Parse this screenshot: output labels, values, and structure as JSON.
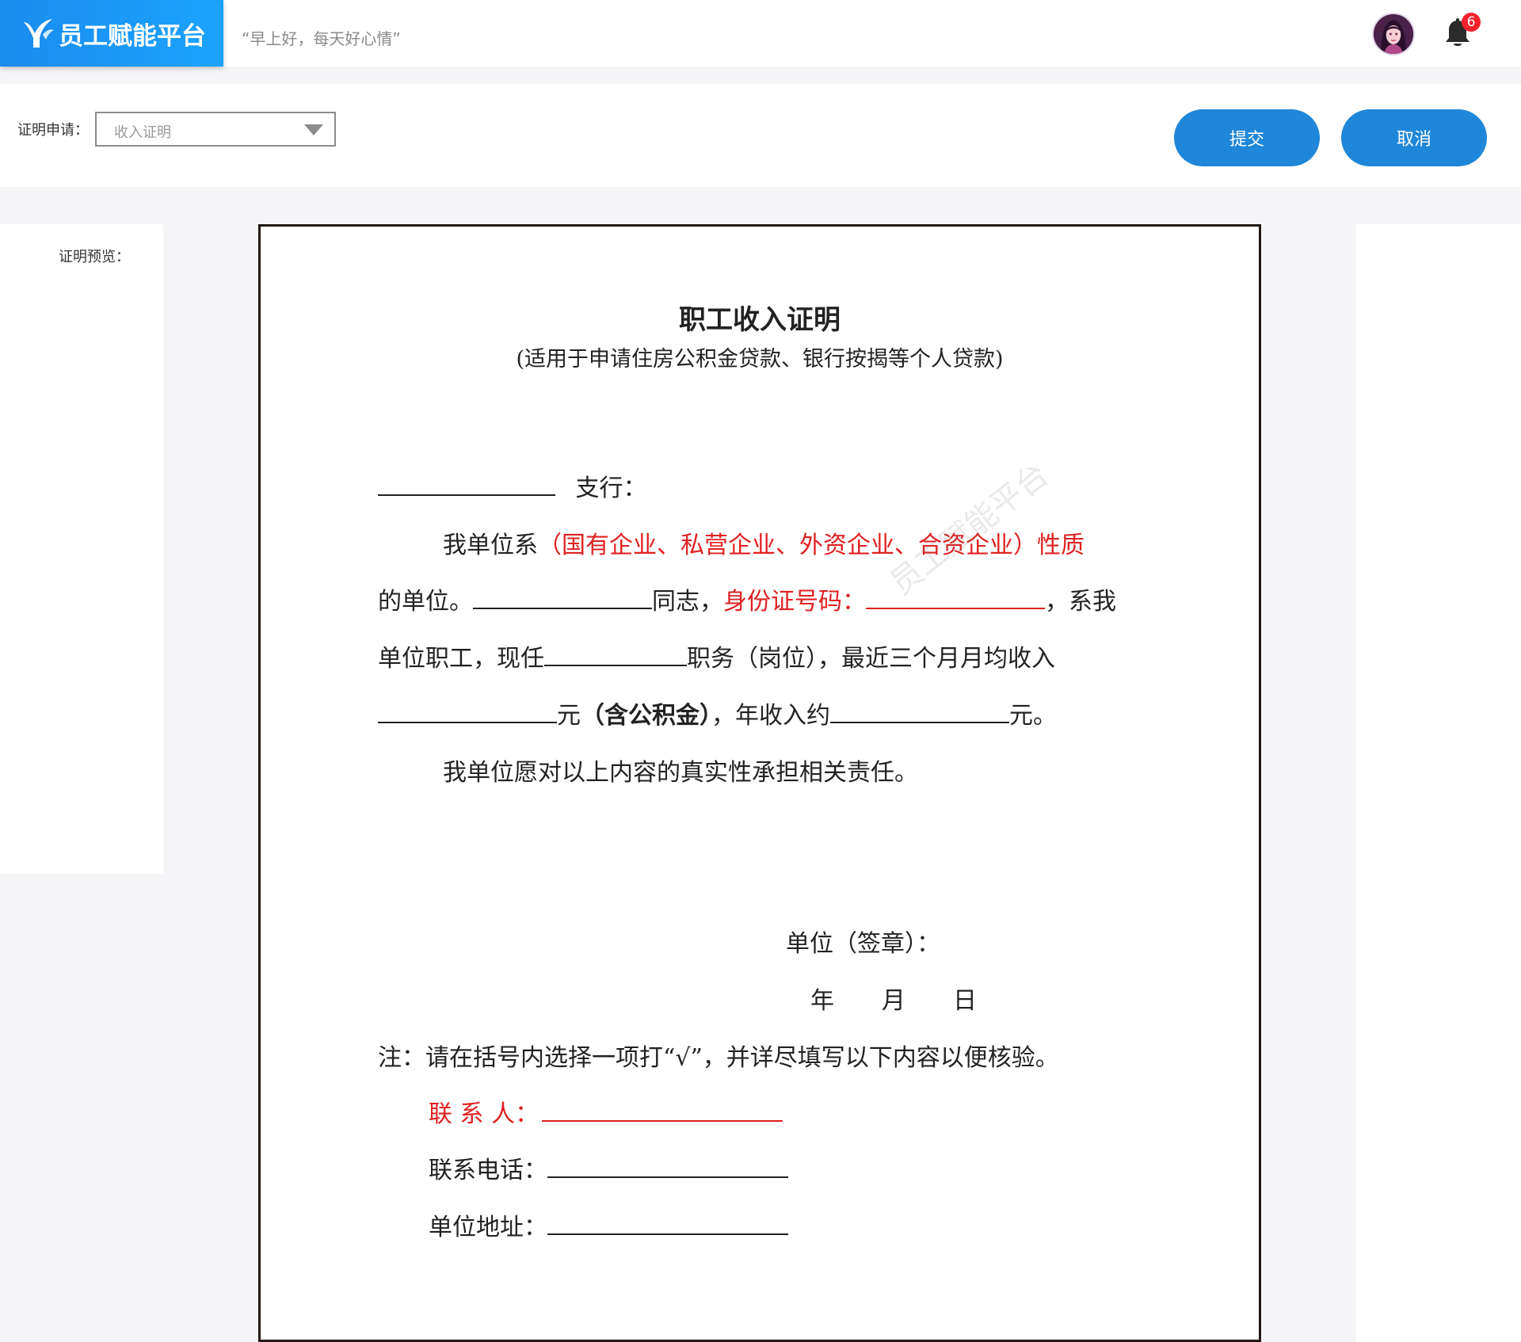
{
  "header": {
    "app_name": "员工赋能平台",
    "greeting": "“早上好，每天好心情”",
    "notification_count": "6"
  },
  "toolbar": {
    "cert_label": "证明申请：",
    "cert_type": "收入证明",
    "submit_label": "提交",
    "cancel_label": "取消"
  },
  "preview": {
    "label": "证明预览："
  },
  "document": {
    "title": "职工收入证明",
    "subtitle": "(适用于申请住房公积金贷款、银行按揭等个人贷款)",
    "branch_suffix": "支行：",
    "p1_start": "我单位系",
    "p1_options": "（国有企业、私营企业、外资企业、合资企业）性质",
    "p2_start": "的单位。",
    "p2_comrade": "同志，",
    "p2_id_label": "身份证号码：",
    "p2_end": "，系我",
    "p3_start": "单位职工，现任",
    "p3_mid": "职务（岗位），最近三个月月均收入",
    "p4_yuan": "元",
    "p4_bold": "（含公积金）",
    "p4_mid": "，年收入约",
    "p4_end": "元。",
    "p5": "我单位愿对以上内容的真实性承担相关责任。",
    "seal": "单位（签章）：",
    "date": "年　　月　　日",
    "note": "注：请在括号内选择一项打“√”，并详尽填写以下内容以便核验。",
    "contact_label": "联 系 人：",
    "phone_label": "联系电话：",
    "address_label": "单位地址：",
    "watermark": "员工赋能平台"
  },
  "colors": {
    "brand": "#1a8cf0",
    "button": "#1f87d9",
    "badge": "#f5222d",
    "highlight": "#e02020"
  },
  "icons": [
    "logo-icon",
    "avatar",
    "bell-icon",
    "chevron-down-icon"
  ]
}
